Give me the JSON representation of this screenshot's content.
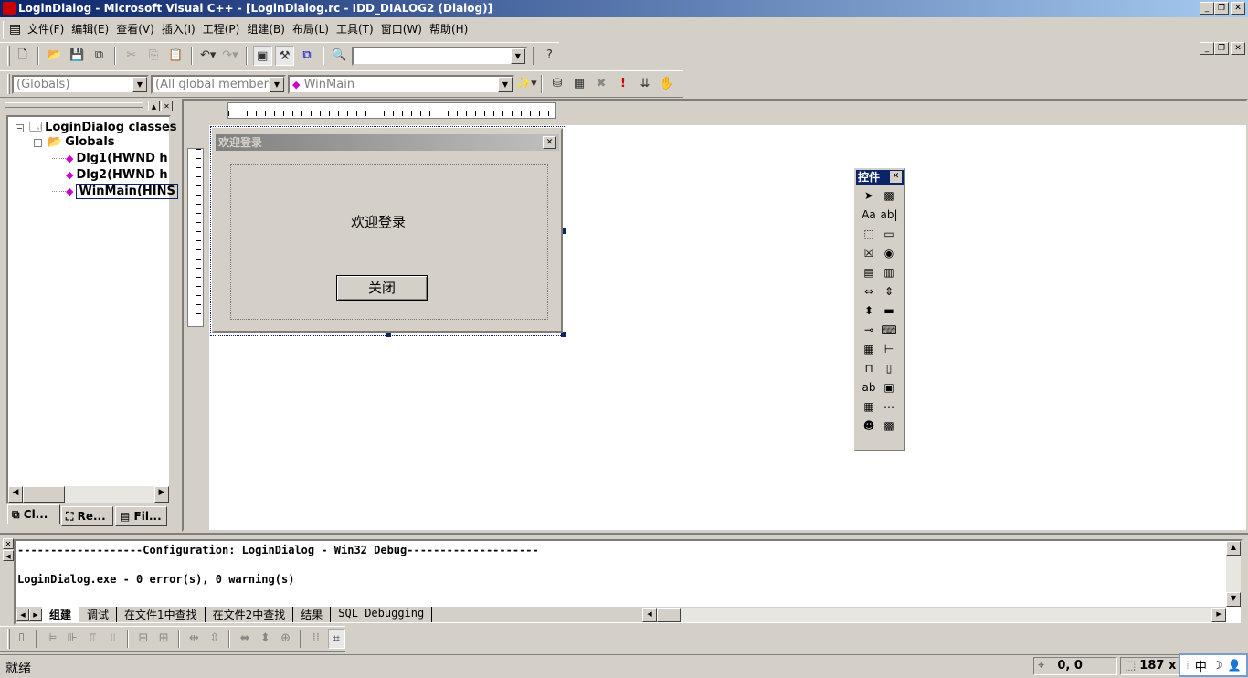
{
  "window": {
    "title": "LoginDialog - Microsoft Visual C++ - [LoginDialog.rc - IDD_DIALOG2 (Dialog)]",
    "controls": [
      "minimize",
      "restore",
      "close"
    ]
  },
  "menu": [
    "文件(F)",
    "编辑(E)",
    "查看(V)",
    "插入(I)",
    "工程(P)",
    "组建(B)",
    "布局(L)",
    "工具(T)",
    "窗口(W)",
    "帮助(H)"
  ],
  "toolbar": {
    "find_combo_value": ""
  },
  "wizardbar": {
    "class_combo": "(Globals)",
    "filter_combo": "(All global members",
    "member_combo": "WinMain"
  },
  "workspace": {
    "tree": [
      {
        "label": "LoginDialog classes",
        "level": 0,
        "icon": "classes-icon"
      },
      {
        "label": "Globals",
        "level": 1,
        "icon": "folder-icon"
      },
      {
        "label": "Dlg1(HWND h",
        "level": 2,
        "icon": "function-icon"
      },
      {
        "label": "Dlg2(HWND h",
        "level": 2,
        "icon": "function-icon"
      },
      {
        "label": "WinMain(HINS",
        "level": 2,
        "icon": "function-icon",
        "selected": true
      }
    ],
    "tabs": [
      "Cl...",
      "Re...",
      "Fil..."
    ]
  },
  "dialog": {
    "title": "欢迎登录",
    "label": "欢迎登录",
    "button": "关闭"
  },
  "palette": {
    "title": "控件"
  },
  "output": {
    "lines": [
      "-------------------Configuration: LoginDialog - Win32 Debug--------------------",
      "",
      "LoginDialog.exe - 0 error(s), 0 warning(s)"
    ],
    "tabs": [
      "组建",
      "调试",
      "在文件1中查找",
      "在文件2中查找",
      "结果",
      "SQL Debugging"
    ],
    "active_tab": "组建"
  },
  "status": {
    "text": "就绪",
    "position": "0, 0",
    "size": "187 x",
    "ime": "中"
  }
}
